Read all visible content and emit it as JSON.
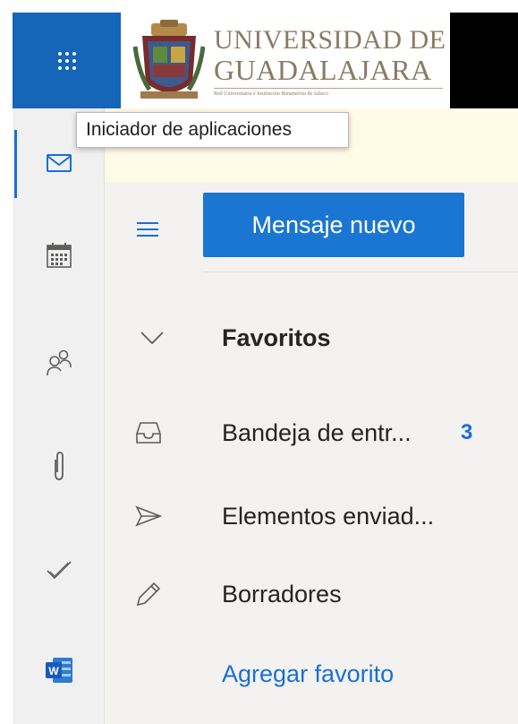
{
  "header": {
    "app_launcher_label": "Iniciador de aplicaciones",
    "logo": {
      "line1": "UNIVERSIDAD DE",
      "line2": "GUADALAJARA",
      "tagline": "Red Universitaria e Institución Benemérita de Jalisco"
    }
  },
  "rail": {
    "items": [
      {
        "name": "mail",
        "icon": "mail-icon",
        "active": true
      },
      {
        "name": "calendar",
        "icon": "calendar-icon"
      },
      {
        "name": "people",
        "icon": "people-icon"
      },
      {
        "name": "files",
        "icon": "paperclip-icon"
      },
      {
        "name": "todo",
        "icon": "checkmark-icon"
      },
      {
        "name": "word",
        "icon": "word-icon",
        "letter": "W"
      }
    ],
    "accent": "#1a6fd4"
  },
  "toolbar": {
    "new_message_label": "Mensaje nuevo"
  },
  "folders": {
    "favorites_label": "Favoritos",
    "items": [
      {
        "label": "Bandeja de entr...",
        "icon": "inbox-icon",
        "count": "3"
      },
      {
        "label": "Elementos enviad...",
        "icon": "send-icon"
      },
      {
        "label": "Borradores",
        "icon": "pencil-icon"
      }
    ],
    "add_favorite_label": "Agregar favorito"
  },
  "colors": {
    "brand_blue": "#1565b8",
    "button_blue": "#1a76d2",
    "notice_yellow": "#fffbe6",
    "pane_bg": "#f3f2f1"
  }
}
